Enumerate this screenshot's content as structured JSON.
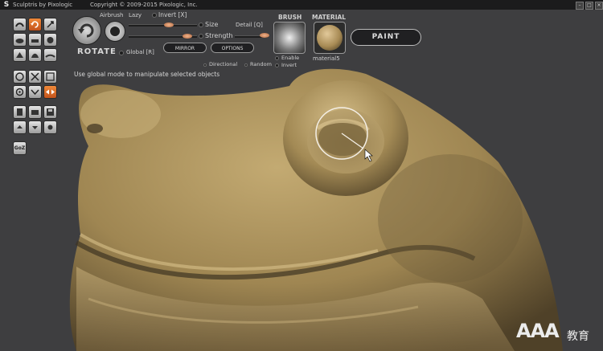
{
  "window": {
    "title": "Sculptris by Pixologic",
    "copyright": "Copyright © 2009-2015 Pixologic, Inc.",
    "controls": [
      "–",
      "□",
      "×"
    ]
  },
  "brush_options": {
    "airbrush_label": "Airbrush",
    "lazy_label": "Lazy",
    "invert_label": "Invert [X]",
    "size_label": "Size",
    "strength_label": "Strength",
    "detail_label": "Detail [Q]",
    "global_label": "Global [R]",
    "mirror_label": "MIRROR",
    "options_label": "OPTIONS",
    "directional_label": "Directional",
    "random_label": "Random"
  },
  "current_tool": {
    "label": "ROTATE"
  },
  "brush_panel": {
    "heading": "BRUSH",
    "enable_label": "Enable",
    "invert_label": "Invert"
  },
  "material_panel": {
    "heading": "MATERIAL",
    "name": "material5"
  },
  "paint_button": {
    "label": "PAINT"
  },
  "status": {
    "hint": "Use global mode to manipulate selected objects"
  },
  "goz_button": {
    "label": "GoZ"
  },
  "watermark": {
    "brand": "AAA",
    "suffix": "教育"
  },
  "colors": {
    "background": "#3e3e40",
    "model": "#a38a55",
    "accent_orange": "#e0702a",
    "titlebar": "#1b1b1c"
  }
}
